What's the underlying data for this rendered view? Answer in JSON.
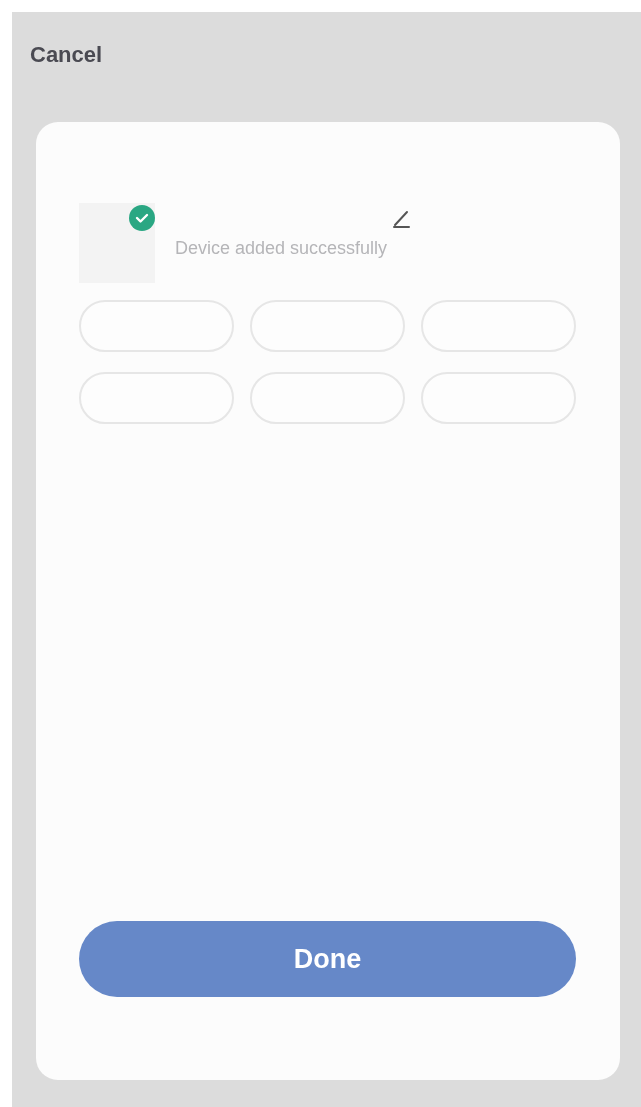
{
  "header": {
    "cancel": "Cancel"
  },
  "device": {
    "added": true,
    "status": "Device added successfully"
  },
  "room_options": [
    {
      "kind": "pill"
    },
    {
      "kind": "pill"
    },
    {
      "kind": "pill"
    },
    {
      "kind": "pill"
    },
    {
      "kind": "pill"
    },
    {
      "kind": "pill"
    }
  ],
  "done_button": "Done"
}
